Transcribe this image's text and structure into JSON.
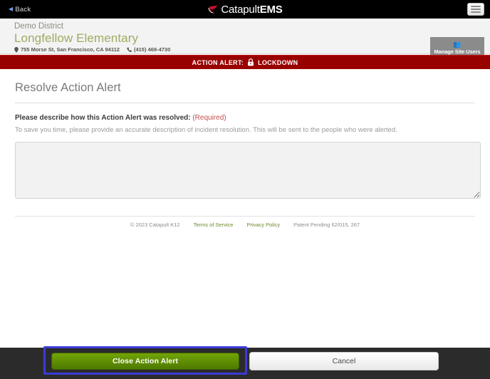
{
  "topbar": {
    "back_label": "Back",
    "brand_first": "Catapult",
    "brand_second": "EMS"
  },
  "school_header": {
    "district": "Demo District",
    "school_name": "Longfellow Elementary",
    "address": "755 Morse St, San Francisco, CA 94112",
    "phone": "(415) 469-4730",
    "manage_site_users_label": "Manage Site Users"
  },
  "alert_strip": {
    "label": "ACTION ALERT:",
    "kind": "LOCKDOWN"
  },
  "main": {
    "heading": "Resolve Action Alert",
    "question": "Please describe how this Action Alert was resolved:",
    "required_tag": "(Required)",
    "subtext": "To save you time, please provide an accurate description of incident resolution. This will be sent to the people who were alerted.",
    "resolution_value": "",
    "resolution_placeholder": ""
  },
  "footer": {
    "copyright": "© 2023 Catapult K12",
    "terms": "Terms of Service",
    "privacy": "Privacy Policy",
    "patent": "Patent Pending 62/015, 267"
  },
  "actions": {
    "primary_label": "Close Action Alert",
    "secondary_label": "Cancel"
  },
  "colors": {
    "alert_red": "#990000",
    "brand_green": "#9eab62",
    "primary_button_green": "#5f8c03",
    "focus_ring_blue": "#3b3bd6",
    "link_green": "#6f8a2e"
  }
}
